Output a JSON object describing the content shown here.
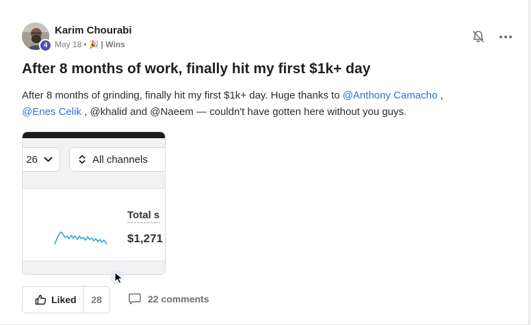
{
  "post": {
    "author": "Karim Chourabi",
    "level": "4",
    "date": "May 18",
    "separator": "•",
    "category_emoji": "🎉",
    "category": "| Wins",
    "title": "After 8 months of work, finally hit my first $1k+ day",
    "body": {
      "part1": "After 8 months of grinding, finally hit my first $1k+ day. Huge thanks to ",
      "mention1": "@Anthony Camacho",
      "part2": " ,",
      "mention2": "@Enes Celik",
      "part3": " , @khalid and @Naeem — couldn't have gotten here without you guys."
    }
  },
  "preview": {
    "date_chip": "26",
    "channels_chip": "All channels",
    "total_label": "Total s",
    "total_value": "$1,271",
    "spark_color": "#29a8df"
  },
  "actions": {
    "like_label": "Liked",
    "like_count": "28",
    "comments_label": "22 comments"
  },
  "icons": {
    "bell": "bell-off-icon",
    "more": "more-horizontal-icon",
    "like": "thumbs-up-icon",
    "comment": "comment-icon"
  },
  "colors": {
    "mention": "#2f6fd6",
    "badge": "#4a4fb5"
  }
}
